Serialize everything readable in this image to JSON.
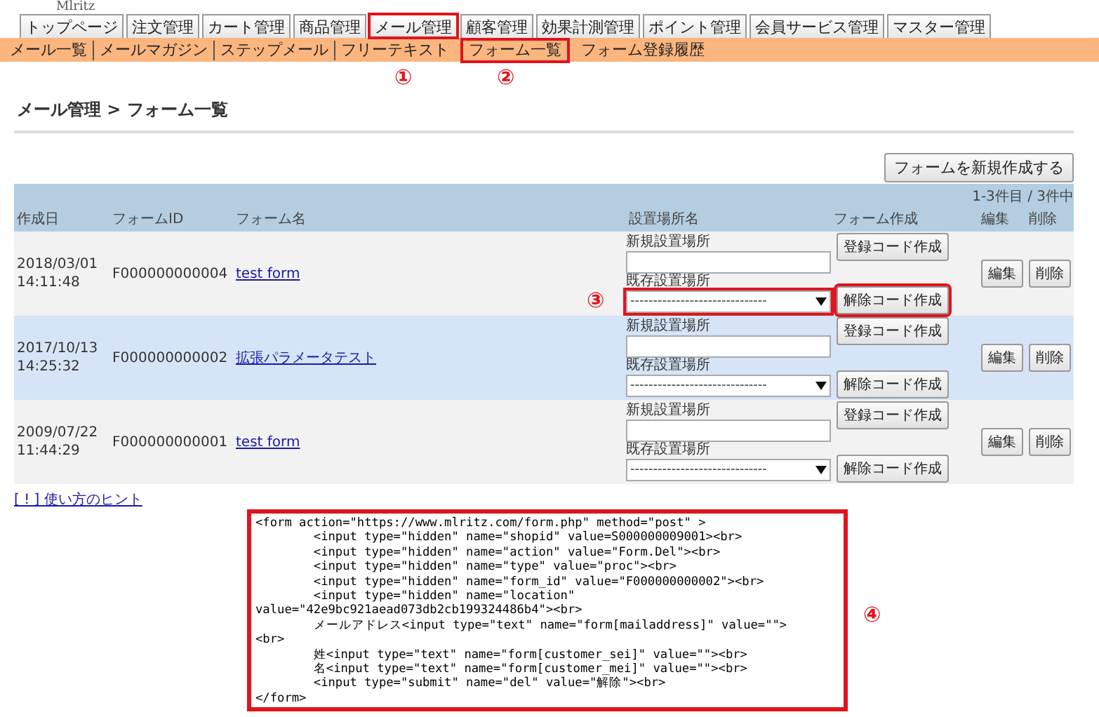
{
  "logo": "Mlritz",
  "main_tabs": [
    {
      "label": "トップページ",
      "highlighted": false
    },
    {
      "label": "注文管理",
      "highlighted": false
    },
    {
      "label": "カート管理",
      "highlighted": false
    },
    {
      "label": "商品管理",
      "highlighted": false
    },
    {
      "label": "メール管理",
      "highlighted": true
    },
    {
      "label": "顧客管理",
      "highlighted": false
    },
    {
      "label": "効果計測管理",
      "highlighted": false
    },
    {
      "label": "ポイント管理",
      "highlighted": false
    },
    {
      "label": "会員サービス管理",
      "highlighted": false
    },
    {
      "label": "マスター管理",
      "highlighted": false
    }
  ],
  "sub_nav": [
    {
      "label": "メール一覧",
      "highlighted": false,
      "divider_after": true
    },
    {
      "label": "メールマガジン",
      "highlighted": false,
      "divider_after": true
    },
    {
      "label": "ステップメール",
      "highlighted": false,
      "divider_after": true
    },
    {
      "label": "フリーテキスト",
      "highlighted": false,
      "divider_after": false
    },
    {
      "label": "フォーム一覧",
      "highlighted": true,
      "divider_after": false
    },
    {
      "label": "フォーム登録履歴",
      "highlighted": false,
      "divider_after": false
    }
  ],
  "callouts": [
    "①",
    "②"
  ],
  "page_title": "メール管理 > フォーム一覧",
  "new_form_button": "フォームを新規作成する",
  "pagination": "1-3件目 / 3件中",
  "columns": [
    "作成日",
    "フォームID",
    "フォーム名",
    "設置場所名",
    "フォーム作成",
    "編集",
    "削除"
  ],
  "rows": [
    {
      "date": "2018/03/01",
      "time": "14:11:48",
      "form_id": "F000000000004",
      "form_name": "test form",
      "new_location_label": "新規設置場所",
      "existing_location_label": "既存設置場所",
      "select_value": "------------------------------",
      "register_button": "登録コード作成",
      "cancel_button": "解除コード作成",
      "edit_button": "編集",
      "delete_button": "削除",
      "highlighted": true,
      "callout": "③"
    },
    {
      "date": "2017/10/13",
      "time": "14:25:32",
      "form_id": "F000000000002",
      "form_name": "拡張パラメータテスト",
      "new_location_label": "新規設置場所",
      "existing_location_label": "既存設置場所",
      "select_value": "------------------------------",
      "register_button": "登録コード作成",
      "cancel_button": "解除コード作成",
      "edit_button": "編集",
      "delete_button": "削除",
      "highlighted": false
    },
    {
      "date": "2009/07/22",
      "time": "11:44:29",
      "form_id": "F000000000001",
      "form_name": "test form",
      "new_location_label": "新規設置場所",
      "existing_location_label": "既存設置場所",
      "select_value": "------------------------------",
      "register_button": "登録コード作成",
      "cancel_button": "解除コード作成",
      "edit_button": "編集",
      "delete_button": "削除",
      "highlighted": false
    }
  ],
  "hint_link": "[ ! ] 使い方のヒント",
  "code_box": {
    "highlighted": true,
    "callout": "④",
    "lines": [
      "<form action=\"https://www.mlritz.com/form.php\" method=\"post\" >",
      "        <input type=\"hidden\" name=\"shopid\" value=S000000009001><br>",
      "        <input type=\"hidden\" name=\"action\" value=\"Form.Del\"><br>",
      "        <input type=\"hidden\" name=\"type\" value=\"proc\"><br>",
      "        <input type=\"hidden\" name=\"form_id\" value=\"F000000000002\"><br>",
      "        <input type=\"hidden\" name=\"location\"",
      "value=\"42e9bc921aead073db2cb199324486b4\"><br>",
      "        メールアドレス<input type=\"text\" name=\"form[mailaddress]\" value=\"\">",
      "<br>",
      "        姓<input type=\"text\" name=\"form[customer_sei]\" value=\"\"><br>",
      "        名<input type=\"text\" name=\"form[customer_mei]\" value=\"\"><br>",
      "        <input type=\"submit\" name=\"del\" value=\"解除\"><br>",
      "</form>"
    ]
  }
}
